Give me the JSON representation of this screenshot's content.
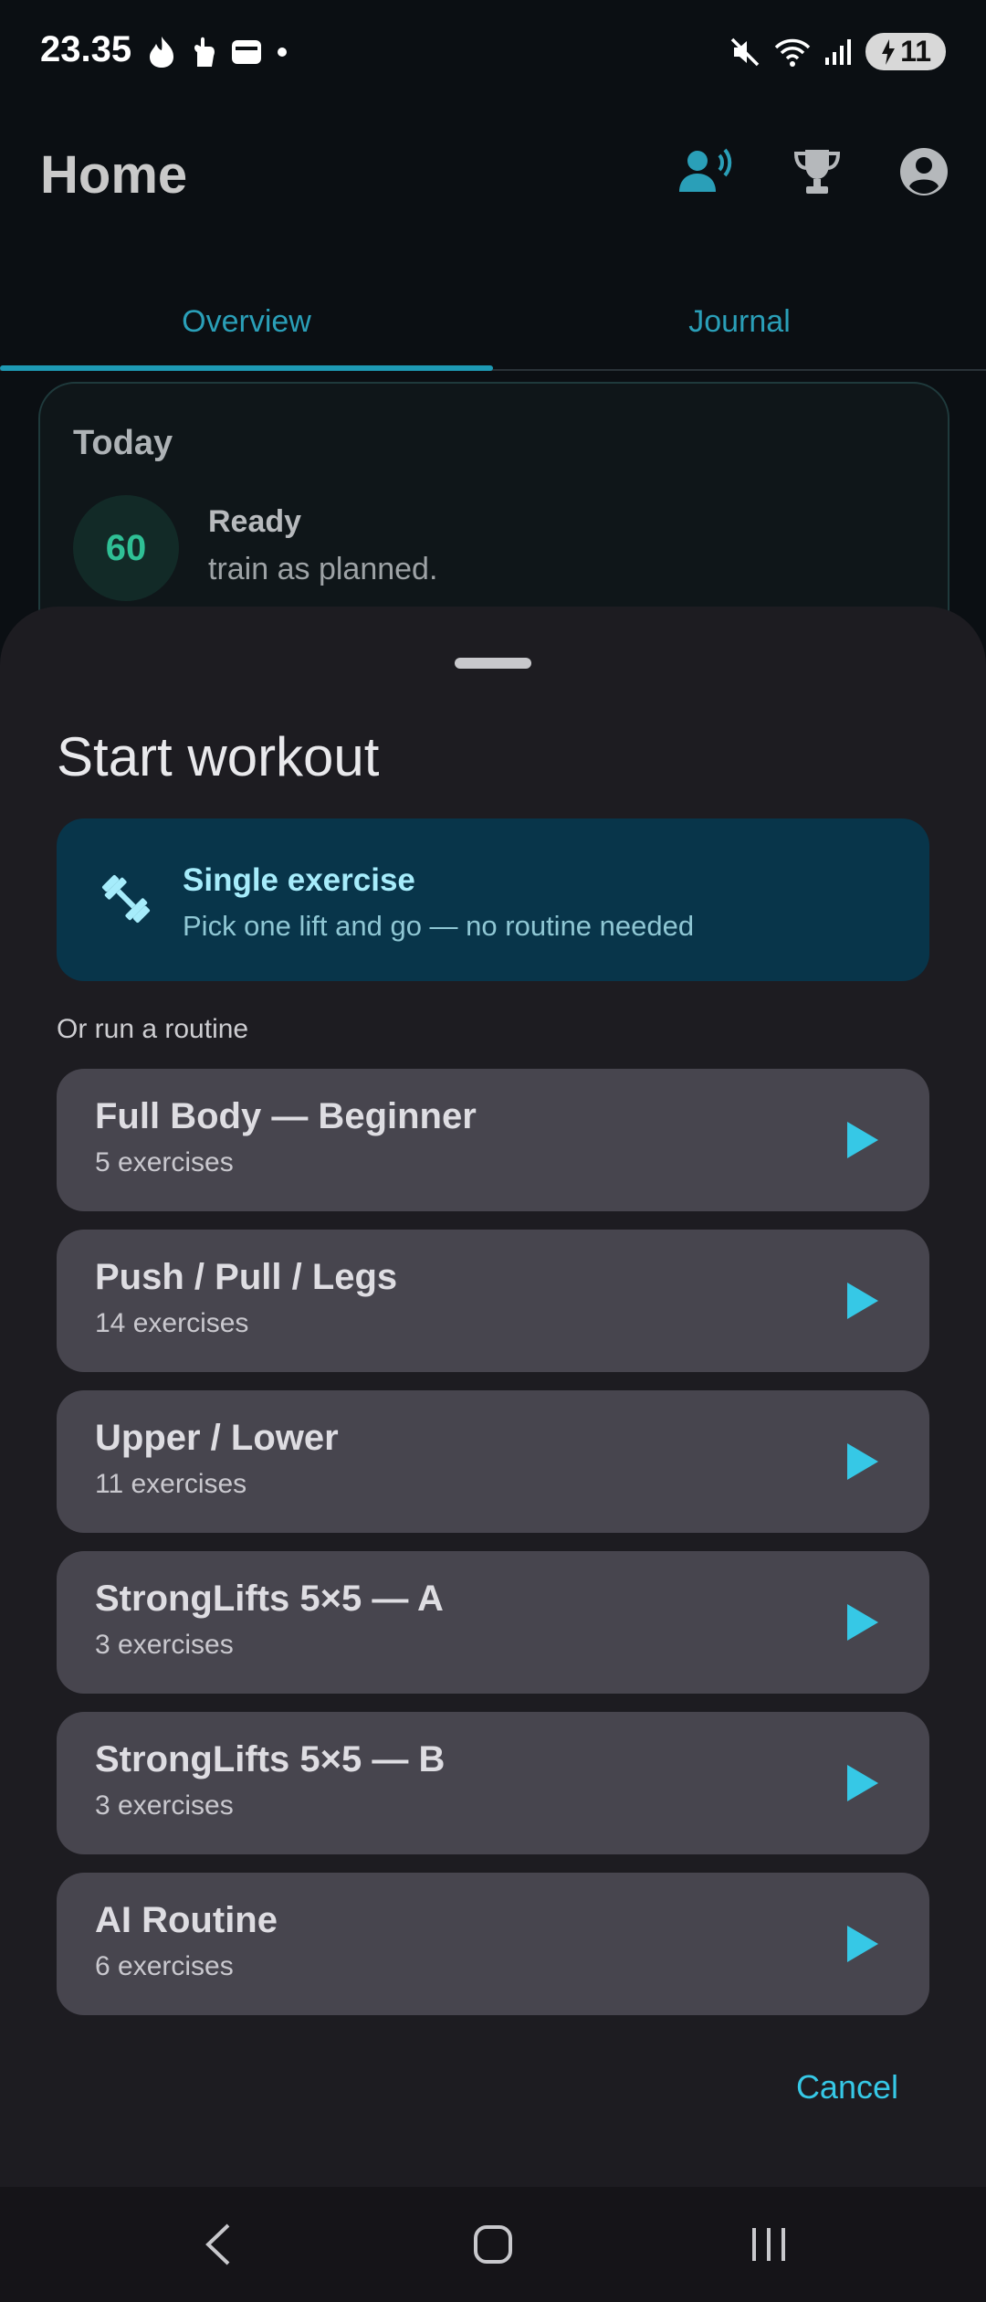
{
  "status_bar": {
    "time": "23.35",
    "battery": "11",
    "icons_left": [
      "flame-icon",
      "hand-icon",
      "wallet-icon",
      "dot-icon"
    ],
    "icons_right": [
      "mute-icon",
      "wifi-icon",
      "signal-icon",
      "battery-icon"
    ]
  },
  "app_bar": {
    "title": "Home",
    "actions": [
      "voice-coach-icon",
      "trophy-icon",
      "account-icon"
    ]
  },
  "tabs": [
    {
      "label": "Overview",
      "active": true
    },
    {
      "label": "Journal",
      "active": false
    }
  ],
  "today": {
    "title": "Today",
    "score": "60",
    "status": "Ready",
    "subtitle": "train as planned."
  },
  "sheet": {
    "title": "Start workout",
    "single_exercise": {
      "title": "Single exercise",
      "subtitle": "Pick one lift and go — no routine needed",
      "icon": "dumbbell-icon"
    },
    "routine_label": "Or run a routine",
    "routines": [
      {
        "name": "Full Body — Beginner",
        "count": "5 exercises"
      },
      {
        "name": "Push / Pull / Legs",
        "count": "14 exercises"
      },
      {
        "name": "Upper / Lower",
        "count": "11 exercises"
      },
      {
        "name": "StrongLifts 5×5 — A",
        "count": "3 exercises"
      },
      {
        "name": "StrongLifts 5×5 — B",
        "count": "3 exercises"
      },
      {
        "name": "AI Routine",
        "count": "6 exercises"
      }
    ],
    "cancel_label": "Cancel"
  },
  "nav_bar": {
    "buttons": [
      "back-icon",
      "home-icon",
      "recents-icon"
    ]
  },
  "colors": {
    "accent": "#36c8e6",
    "sheet_bg": "#1d1c21",
    "routine_bg": "#47454e",
    "single_bg": "#08354a"
  }
}
